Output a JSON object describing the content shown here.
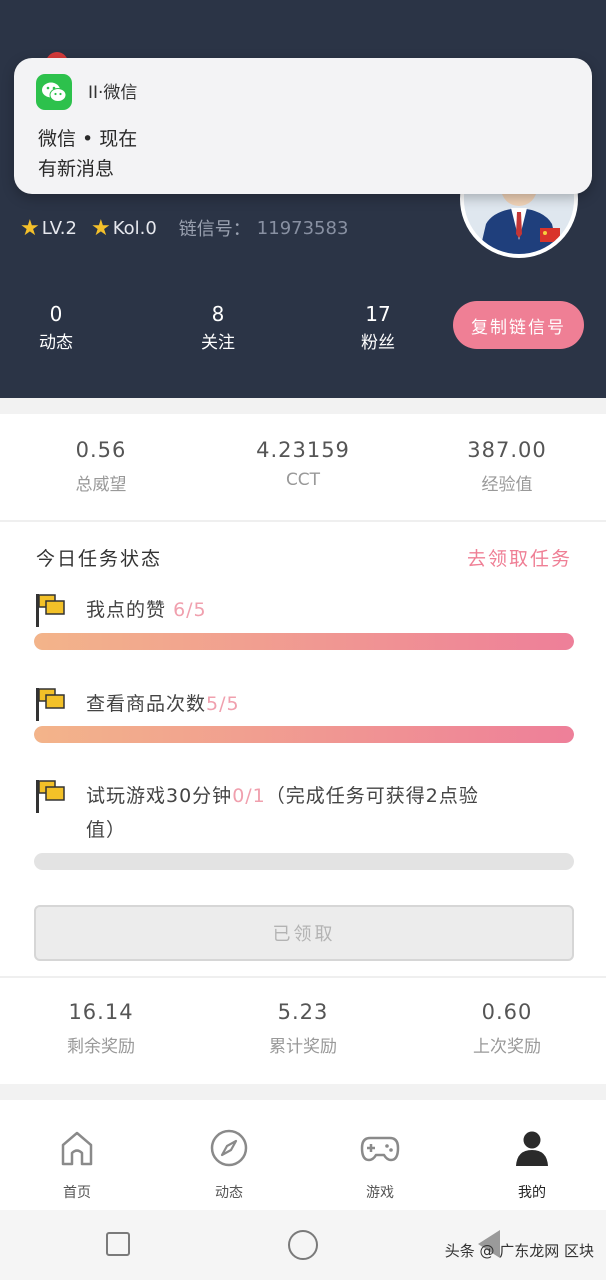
{
  "status_bar": {
    "left": "",
    "right": ""
  },
  "notification": {
    "app_line": "II·微信",
    "title": "微信 • 现在",
    "body": "有新消息",
    "icon": "wechat-icon"
  },
  "profile": {
    "level": "LV.2",
    "kol": "Kol.0",
    "chain_label": "链信号：",
    "chain_id": "11973583",
    "stats": [
      {
        "num": "0",
        "label": "动态"
      },
      {
        "num": "8",
        "label": "关注"
      },
      {
        "num": "17",
        "label": "粉丝"
      }
    ],
    "copy_button": "复制链信号"
  },
  "metrics": [
    {
      "value": "0.56",
      "label": "总威望"
    },
    {
      "value": "4.23159",
      "label": "CCT"
    },
    {
      "value": "387.00",
      "label": "经验值"
    }
  ],
  "tasks": {
    "title": "今日任务状态",
    "link": "去领取任务",
    "items": [
      {
        "label": "我点的赞",
        "progress_text": "6/5",
        "fill_percent": 100
      },
      {
        "label": "查看商品次数",
        "progress_text": "5/5",
        "fill_percent": 100
      },
      {
        "label_a": "试玩游戏30分钟",
        "progress_text": "0/1",
        "label_b": "（完成任务可获得2点验",
        "label_c": "值）",
        "fill_percent": 0
      }
    ],
    "claimed_button": "已领取"
  },
  "rewards": [
    {
      "value": "16.14",
      "label": "剩余奖励"
    },
    {
      "value": "5.23",
      "label": "累计奖励"
    },
    {
      "value": "0.60",
      "label": "上次奖励"
    }
  ],
  "bottom_nav": [
    {
      "label": "首页",
      "icon": "home-icon"
    },
    {
      "label": "动态",
      "icon": "compass-icon"
    },
    {
      "label": "游戏",
      "icon": "gamepad-icon"
    },
    {
      "label": "我的",
      "icon": "person-icon"
    }
  ],
  "watermark": "头条 @ 广东龙网 区块",
  "colors": {
    "header_bg": "#2b3446",
    "accent_pink": "#ef7f95",
    "star": "#f4c02a"
  }
}
